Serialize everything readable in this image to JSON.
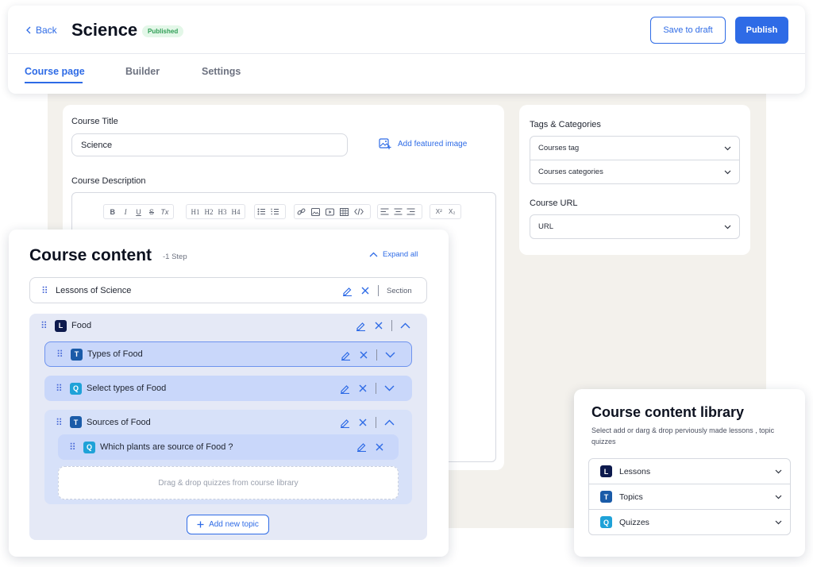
{
  "header": {
    "back_label": "Back",
    "title": "Science",
    "status_badge": "Published",
    "save_draft_label": "Save to draft",
    "publish_label": "Publish",
    "tabs": [
      {
        "label": "Course page",
        "active": true
      },
      {
        "label": "Builder",
        "active": false
      },
      {
        "label": "Settings",
        "active": false
      }
    ]
  },
  "course_details": {
    "title_label": "Course Title",
    "title_value": "Science",
    "featured_image_label": "Add featured image",
    "description_label": "Course Description",
    "toolbar": {
      "format": [
        "B",
        "I",
        "U",
        "S",
        "Tx"
      ],
      "headings": [
        "H1",
        "H2",
        "H3",
        "H4"
      ],
      "lists": [
        "bulleted-list-icon",
        "numbered-list-icon"
      ],
      "media": [
        "link-icon",
        "image-icon",
        "video-icon",
        "table-icon",
        "code-icon"
      ],
      "align": [
        "align-left-icon",
        "align-center-icon",
        "align-right-icon"
      ],
      "script": [
        "X²",
        "X₂"
      ]
    }
  },
  "sidebar": {
    "tags_label": "Tags & Categories",
    "courses_tag": "Courses tag",
    "courses_categories": "Courses categories",
    "url_label": "Course URL",
    "url_value": "URL"
  },
  "course_content": {
    "title": "Course content",
    "step_count": "-1 Step",
    "expand_all_label": "Expand all",
    "section": {
      "label": "Lessons of Science",
      "tag": "Section"
    },
    "lesson": {
      "type": "L",
      "label": "Food",
      "topics": [
        {
          "type": "T",
          "label": "Types of Food"
        },
        {
          "type": "Q",
          "label": "Select types of Food"
        },
        {
          "type": "T",
          "label": "Sources of Food",
          "children": [
            {
              "type": "Q",
              "label": "Which plants are source of Food ?"
            }
          ]
        }
      ],
      "drop_zone": "Drag & drop quizzes from course library",
      "add_topic_label": "Add new topic"
    }
  },
  "library": {
    "title": "Course content library",
    "subtitle": "Select add or darg & drop perviously made lessons , topic quizzes",
    "items": [
      {
        "type": "L",
        "label": "Lessons"
      },
      {
        "type": "T",
        "label": "Topics"
      },
      {
        "type": "Q",
        "label": "Quizzes"
      }
    ]
  },
  "colors": {
    "accent": "#2e6be6",
    "badge_bg": "#e3f7e8",
    "badge_text": "#2f9e55",
    "lesson_icon": "#0d1a4d",
    "topic_icon": "#1a5ba8",
    "quiz_icon": "#1fa2d8",
    "lesson_bg": "#e5e9f6",
    "topic_row_bg": "#c9d7fa"
  }
}
